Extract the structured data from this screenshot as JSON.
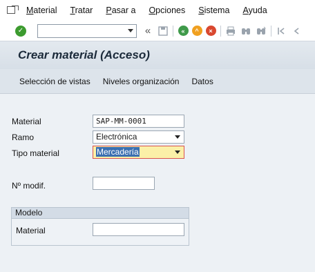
{
  "menu": {
    "items": [
      {
        "first": "M",
        "rest": "aterial"
      },
      {
        "first": "T",
        "rest": "ratar"
      },
      {
        "first": "P",
        "rest": "asar a"
      },
      {
        "first": "O",
        "rest": "pciones"
      },
      {
        "first": "S",
        "rest": "istema"
      },
      {
        "first": "A",
        "rest": "yuda"
      }
    ]
  },
  "toolbar": {
    "command_value": "",
    "back_glyph": "«"
  },
  "title": "Crear material (Acceso)",
  "app_toolbar": {
    "buttons": [
      "Selección de vistas",
      "Niveles organización",
      "Datos"
    ]
  },
  "form": {
    "material_label": "Material",
    "material_value": "SAP-MM-0001",
    "ramo_label": "Ramo",
    "ramo_value": "Electrónica",
    "tipo_label": "Tipo material",
    "tipo_value": "Mercadería",
    "modif_label": "Nº modif.",
    "modif_value": "",
    "group_title": "Modelo",
    "model_material_label": "Material",
    "model_material_value": ""
  },
  "colors": {
    "ok_green": "#3c9b2f",
    "cancel_red": "#d9482f",
    "exit_orange": "#f0a020",
    "back_green": "#3f9a4a",
    "focus_yellow": "#fbf0a8"
  }
}
